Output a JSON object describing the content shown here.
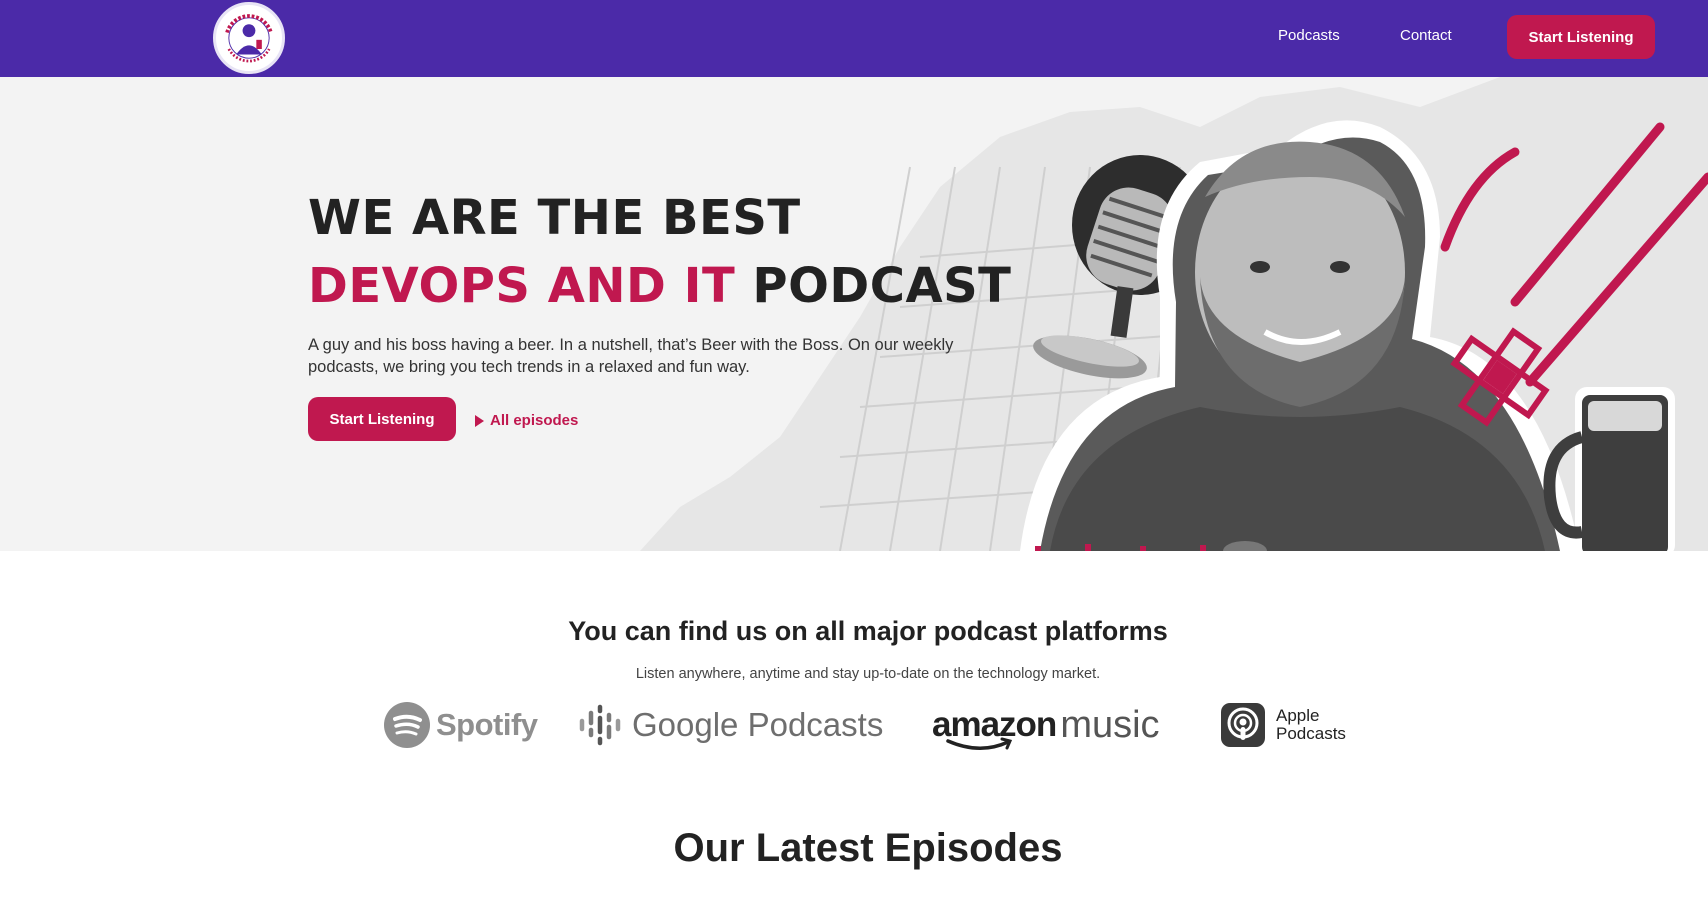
{
  "nav": {
    "logo_text_top": "BEER WITH THE BOSS",
    "logo_text_bottom": "WEEKLY TECH TALKS",
    "links": [
      "Podcasts",
      "Contact"
    ],
    "cta_label": "Start Listening"
  },
  "hero": {
    "title_line1": "WE ARE THE BEST",
    "title_accent": "DEVOPS AND IT",
    "title_rest": " PODCAST",
    "subtitle": "A guy and his boss having a beer. In a nutshell, that’s Beer with the Boss. On our weekly podcasts, we bring you tech trends in a relaxed and fun way.",
    "cta_label": "Start Listening",
    "secondary_label": "All episodes"
  },
  "platforms": {
    "title": "You can find us on all major podcast platforms",
    "subtitle": "Listen anywhere, anytime and stay up-to-date on the technology market.",
    "spotify": "Spotify",
    "google": "Google Podcasts",
    "amazon_1": "amazon",
    "amazon_2": "music",
    "apple_1": "Apple",
    "apple_2": "Podcasts"
  },
  "latest": {
    "title": "Our Latest Episodes"
  },
  "colors": {
    "nav_bg": "#4b2aa8",
    "accent": "#c0184f",
    "hero_bg": "#f3f3f3"
  }
}
